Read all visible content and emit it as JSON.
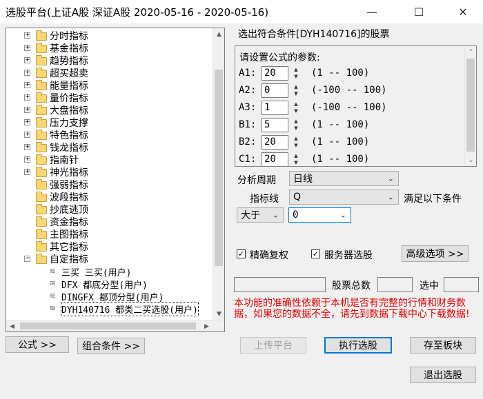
{
  "window": {
    "title": "选股平台(上证A股 深证A股   2020-05-16 - 2020-05-16)",
    "minimize_glyph": "—",
    "maximize_glyph": "☐",
    "close_glyph": "✕"
  },
  "tree": {
    "items": [
      {
        "label": "分时指标",
        "type": "folder",
        "expandable": true
      },
      {
        "label": "基金指标",
        "type": "folder",
        "expandable": true
      },
      {
        "label": "趋势指标",
        "type": "folder",
        "expandable": true
      },
      {
        "label": "超买超卖",
        "type": "folder",
        "expandable": true
      },
      {
        "label": "能量指标",
        "type": "folder",
        "expandable": true
      },
      {
        "label": "量价指标",
        "type": "folder",
        "expandable": true
      },
      {
        "label": "大盘指标",
        "type": "folder",
        "expandable": true
      },
      {
        "label": "压力支撑",
        "type": "folder",
        "expandable": true
      },
      {
        "label": "特色指标",
        "type": "folder",
        "expandable": true
      },
      {
        "label": "钱龙指标",
        "type": "folder",
        "expandable": true
      },
      {
        "label": "指南针",
        "type": "folder",
        "expandable": true
      },
      {
        "label": "神光指标",
        "type": "folder",
        "expandable": true
      },
      {
        "label": "强弱指标",
        "type": "folder",
        "expandable": false
      },
      {
        "label": "波段指标",
        "type": "folder",
        "expandable": false
      },
      {
        "label": "抄底逃顶",
        "type": "folder",
        "expandable": false
      },
      {
        "label": "资金指标",
        "type": "folder",
        "expandable": false
      },
      {
        "label": "主图指标",
        "type": "folder",
        "expandable": false
      },
      {
        "label": "其它指标",
        "type": "folder",
        "expandable": false
      },
      {
        "label": "自定指标",
        "type": "folder",
        "expandable": true,
        "expanded": true
      },
      {
        "label": "三买  三买(用户)",
        "type": "formula"
      },
      {
        "label": "DFX 都底分型(用户)",
        "type": "formula"
      },
      {
        "label": "DINGFX 都顶分型(用户)",
        "type": "formula"
      },
      {
        "label": "DYH140716 都类二买选股(用户)",
        "type": "formula",
        "selected": true
      }
    ]
  },
  "left_buttons": {
    "formula": "公式 >>",
    "combo": "组合条件 >>"
  },
  "condition": {
    "header": "选出符合条件[DYH140716]的股票",
    "params_prompt": "请设置公式的参数:",
    "params": [
      {
        "name": "A1:",
        "value": "20",
        "range": "(1 -- 100)"
      },
      {
        "name": "A2:",
        "value": "0",
        "range": "(-100 -- 100)"
      },
      {
        "name": "A3:",
        "value": "1",
        "range": "(-100 -- 100)"
      },
      {
        "name": "B1:",
        "value": "5",
        "range": "(1 -- 100)"
      },
      {
        "name": "B2:",
        "value": "20",
        "range": "(1 -- 100)"
      },
      {
        "name": "C1:",
        "value": "20",
        "range": "(1 -- 100)"
      }
    ],
    "period_label": "分析周期",
    "period_value": "日线",
    "indicator_label": "指标线",
    "indicator_value": "Q",
    "satisfy_label": "满足以下条件",
    "compare_value": "大于",
    "threshold_value": "0"
  },
  "options": {
    "exact_fq_label": "精确复权",
    "exact_fq_checked": true,
    "server_label": "服务器选股",
    "server_checked": true,
    "advanced": "高级选项 >>"
  },
  "stats": {
    "total_label": "股票总数",
    "selected_label": "选中"
  },
  "warning": "本功能的准确性依赖于本机是否有完整的行情和财务数据，如果您的数据不全，请先到数据下载中心下载数据!",
  "actions": {
    "upload": "上传平台",
    "execute": "执行选股",
    "save": "存至板块",
    "exit": "退出选股"
  },
  "colors": {
    "accent": "#0078d7",
    "warning": "#e00000",
    "folder": "#f8d775"
  }
}
